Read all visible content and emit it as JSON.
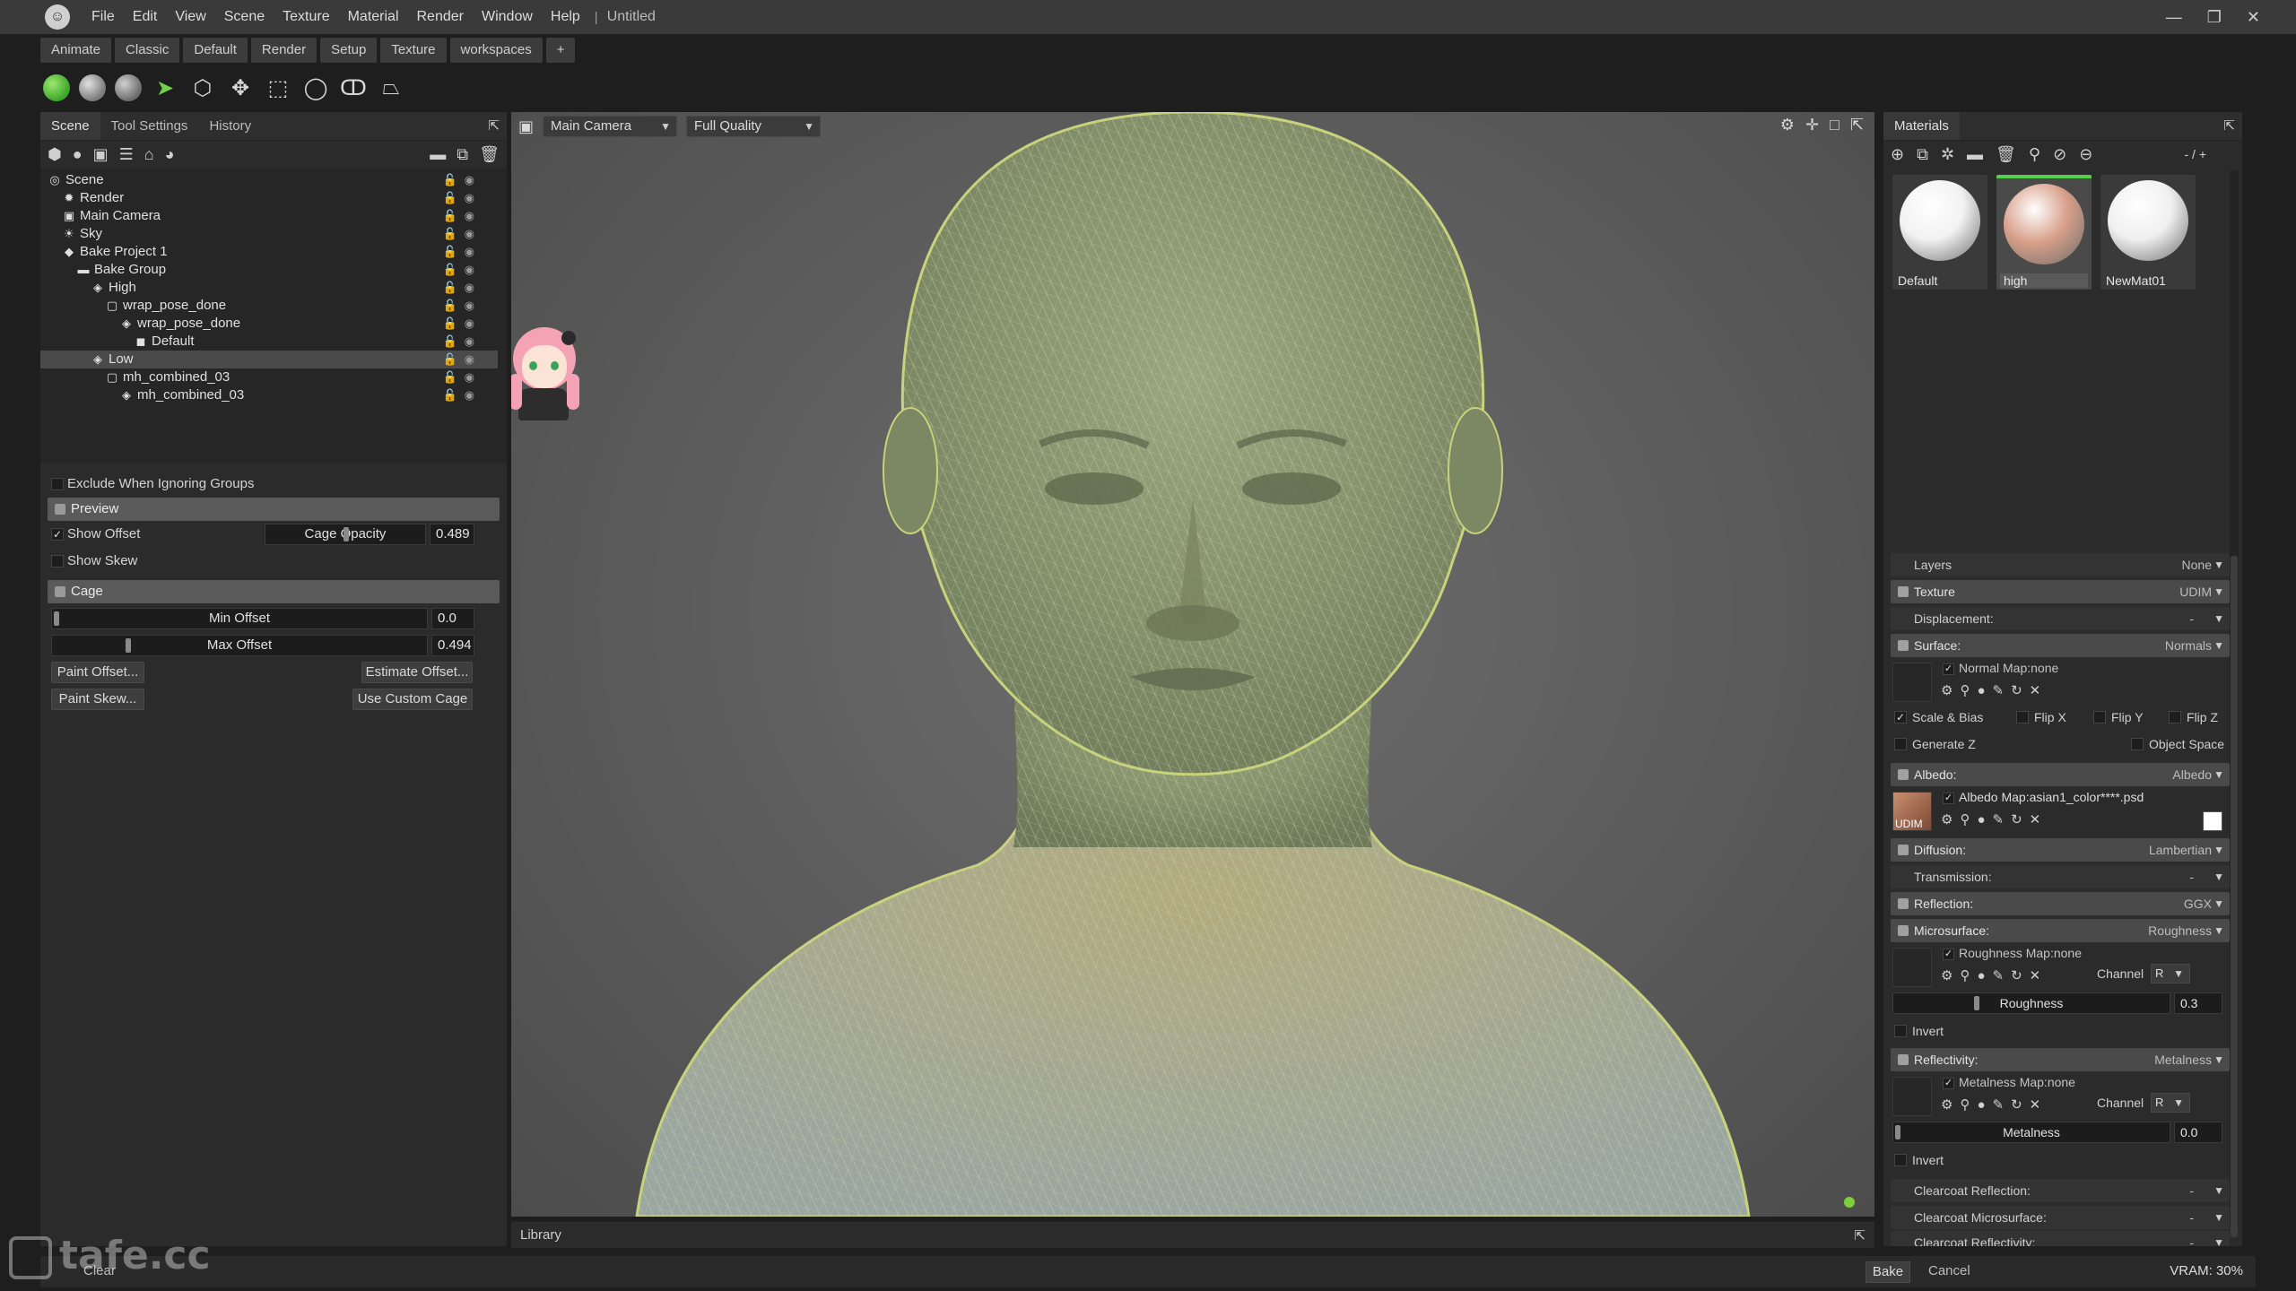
{
  "app": {
    "menu": [
      "File",
      "Edit",
      "View",
      "Scene",
      "Texture",
      "Material",
      "Render",
      "Window",
      "Help"
    ],
    "doc_title": "Untitled",
    "window_controls": [
      "minimize",
      "maximize",
      "close"
    ]
  },
  "workspace_tabs": [
    "Animate",
    "Classic",
    "Default",
    "Render",
    "Setup",
    "Texture",
    "workspaces",
    "+"
  ],
  "left_panel": {
    "tabs": [
      "Scene",
      "Tool Settings",
      "History"
    ],
    "tree": [
      {
        "label": "Scene",
        "indent": 0,
        "icon": "scene-icon"
      },
      {
        "label": "Render",
        "indent": 1,
        "icon": "render-icon"
      },
      {
        "label": "Main Camera",
        "indent": 1,
        "icon": "camera-icon"
      },
      {
        "label": "Sky",
        "indent": 1,
        "icon": "sky-icon"
      },
      {
        "label": "Bake Project 1",
        "indent": 1,
        "icon": "bake-project-icon"
      },
      {
        "label": "Bake Group",
        "indent": 2,
        "icon": "folder-icon"
      },
      {
        "label": "High",
        "indent": 3,
        "icon": "mesh-icon"
      },
      {
        "label": "wrap_pose_done",
        "indent": 4,
        "icon": "object-icon"
      },
      {
        "label": "wrap_pose_done",
        "indent": 5,
        "icon": "mesh-icon"
      },
      {
        "label": "Default",
        "indent": 6,
        "icon": "material-icon"
      },
      {
        "label": "Low",
        "indent": 3,
        "icon": "mesh-icon",
        "selected": true
      },
      {
        "label": "mh_combined_03",
        "indent": 4,
        "icon": "object-icon"
      },
      {
        "label": "mh_combined_03",
        "indent": 5,
        "icon": "mesh-icon"
      }
    ],
    "exclude_label": "Exclude When Ignoring Groups",
    "preview": {
      "title": "Preview",
      "show_offset_label": "Show Offset",
      "show_offset_checked": true,
      "cage_opacity_label": "Cage Opacity",
      "cage_opacity_value": "0.489",
      "show_skew_label": "Show Skew",
      "show_skew_checked": false
    },
    "cage": {
      "title": "Cage",
      "min_offset_label": "Min Offset",
      "min_offset_value": "0.0",
      "max_offset_label": "Max Offset",
      "max_offset_value": "0.494",
      "paint_offset_label": "Paint Offset...",
      "estimate_offset_label": "Estimate Offset...",
      "paint_skew_label": "Paint Skew...",
      "use_custom_cage_label": "Use Custom Cage"
    }
  },
  "viewport": {
    "camera": "Main Camera",
    "quality": "Full Quality",
    "library_label": "Library"
  },
  "right_panel": {
    "title": "Materials",
    "counter": "- / +",
    "materials": [
      {
        "name": "Default",
        "color": "#f2f2f2",
        "selected": false
      },
      {
        "name": "high",
        "color": "#d8a08a",
        "selected": true
      },
      {
        "name": "NewMat01",
        "color": "#f0f0f0",
        "selected": false
      }
    ],
    "layers": {
      "label": "Layers",
      "value": "None"
    },
    "texture": {
      "label": "Texture",
      "value": "UDIM"
    },
    "displacement": {
      "label": "Displacement:",
      "value": "-"
    },
    "surface": {
      "label": "Surface:",
      "value": "Normals"
    },
    "normal_map": "Normal Map:none",
    "scale_bias_label": "Scale & Bias",
    "flip_x_label": "Flip X",
    "flip_y_label": "Flip Y",
    "flip_z_label": "Flip Z",
    "generate_z_label": "Generate Z",
    "object_space_label": "Object Space",
    "albedo": {
      "label": "Albedo:",
      "value": "Albedo"
    },
    "albedo_map": "Albedo Map:asian1_color****.psd",
    "albedo_thumb_tag": "UDIM",
    "diffusion": {
      "label": "Diffusion:",
      "value": "Lambertian"
    },
    "transmission": {
      "label": "Transmission:",
      "value": "-"
    },
    "reflection": {
      "label": "Reflection:",
      "value": "GGX"
    },
    "microsurface": {
      "label": "Microsurface:",
      "value": "Roughness"
    },
    "roughness_map": "Roughness Map:none",
    "channel_label": "Channel",
    "roughness_channel": "R",
    "roughness_label": "Roughness",
    "roughness_value": "0.3",
    "invert_label": "Invert",
    "reflectivity": {
      "label": "Reflectivity:",
      "value": "Metalness"
    },
    "metalness_map": "Metalness Map:none",
    "metalness_channel": "R",
    "metalness_label": "Metalness",
    "metalness_value": "0.0",
    "clearcoat_reflection": {
      "label": "Clearcoat Reflection:",
      "value": "-"
    },
    "clearcoat_microsurface": {
      "label": "Clearcoat Microsurface:",
      "value": "-"
    },
    "clearcoat_reflectivity": {
      "label": "Clearcoat Reflectivity:",
      "value": "-"
    }
  },
  "bottom_bar": {
    "clear_label": "Clear",
    "bake_label": "Bake",
    "cancel_label": "Cancel",
    "vram_label": "VRAM: 30%"
  },
  "watermark": "tafe.cc",
  "colors": {
    "accent_green": "#55d04b",
    "wireframe": "#b8c49a",
    "viewport_bg": "#5e5e5e"
  }
}
